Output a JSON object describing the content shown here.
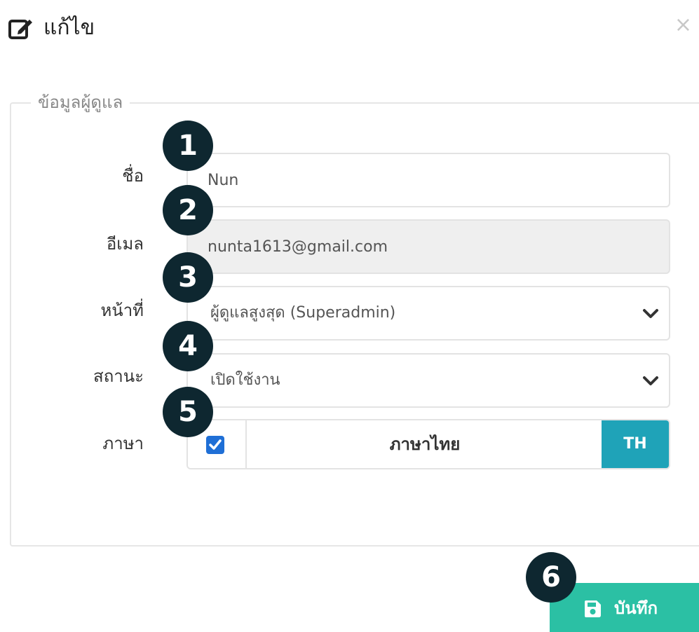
{
  "header": {
    "title": "แก้ไข",
    "close": "×"
  },
  "section": {
    "legend": "ข้อมูลผู้ดูแล"
  },
  "fields": {
    "name": {
      "label": "ชื่อ",
      "value": "Nun"
    },
    "email": {
      "label": "อีเมล",
      "value": "nunta1613@gmail.com"
    },
    "role": {
      "label": "หน้าที่",
      "value": "ผู้ดูแลสูงสุด (Superadmin)"
    },
    "status": {
      "label": "สถานะ",
      "value": "เปิดใช้งาน"
    },
    "language": {
      "label": "ภาษา",
      "name": "ภาษาไทย",
      "code": "TH",
      "checked": true
    }
  },
  "badges": [
    "1",
    "2",
    "3",
    "4",
    "5",
    "6"
  ],
  "footer": {
    "save_label": "บันทึก"
  },
  "colors": {
    "accent": "#1fa3b8",
    "save": "#2bc0a4",
    "checkbox": "#1f6fd6",
    "badge": "#0e2730"
  }
}
